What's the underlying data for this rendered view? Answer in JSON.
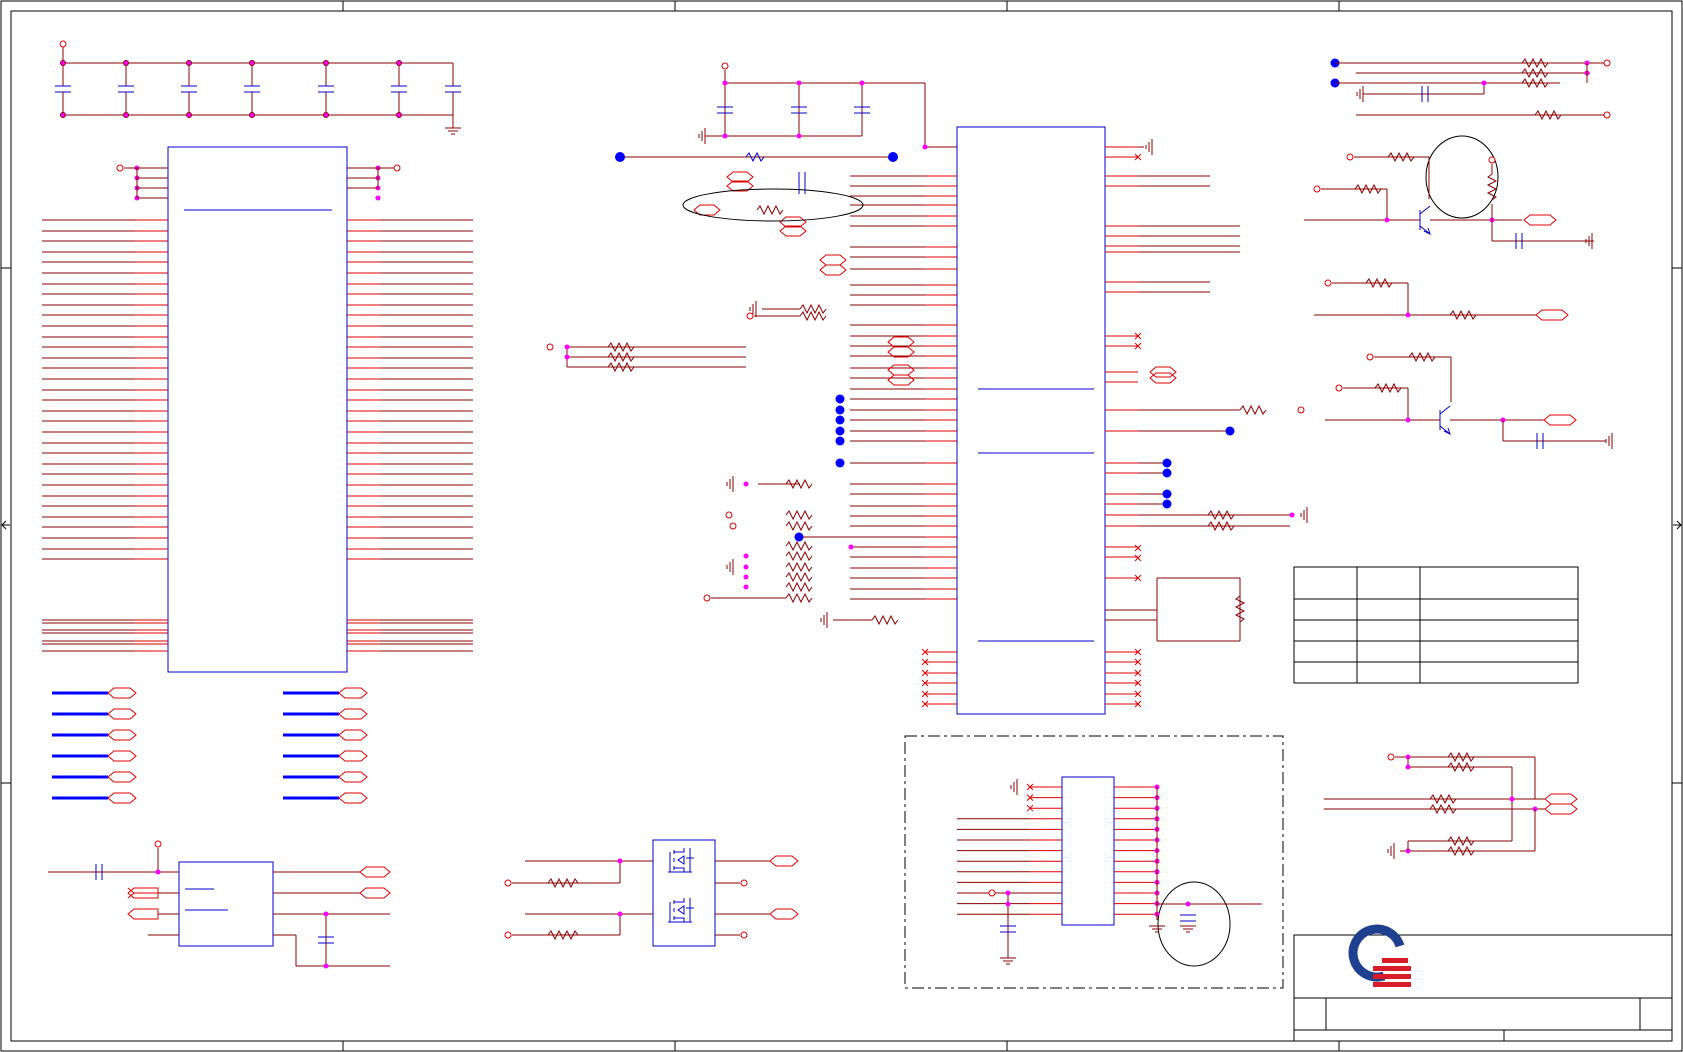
{
  "sheet": {
    "title": "",
    "border_ticks": true
  },
  "colors": {
    "wire": "#8b0000",
    "net": "#e00000",
    "part": "#0000cc",
    "junction": "#ff00ff",
    "border": "#000000",
    "logo_blue": "#1f3f8f",
    "logo_red": "#d81c2a"
  },
  "title_block": {
    "logo": "company-logo",
    "company_name": "",
    "document_title": ""
  },
  "revision_table": {
    "headers": [
      "",
      "",
      ""
    ],
    "rows": [
      [
        "",
        "",
        ""
      ],
      [
        "",
        "",
        ""
      ],
      [
        "",
        "",
        ""
      ]
    ]
  },
  "components": {
    "connector_left": "large-connector",
    "main_ic": "main-ic",
    "small_ic": "small-ic",
    "mosfet_pair": "dual-mosfet",
    "dashed_block": "optional-section",
    "transistor_1": "npn-transistor",
    "transistor_2": "npn-transistor"
  }
}
